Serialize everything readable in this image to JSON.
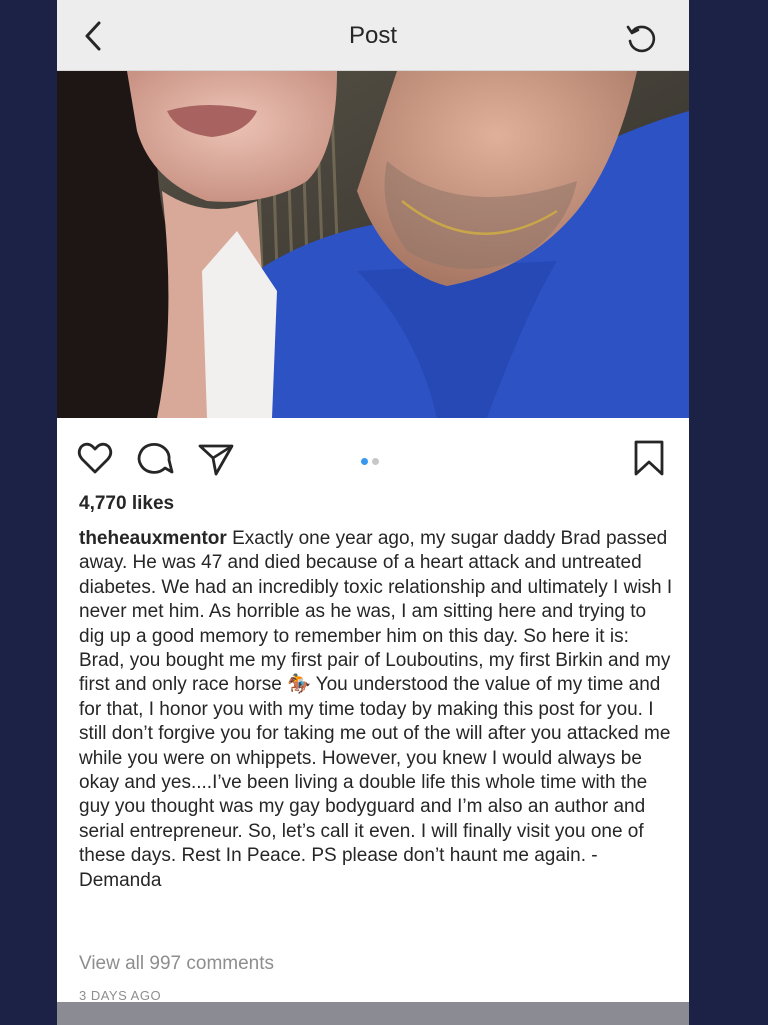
{
  "header": {
    "title": "Post",
    "back_icon": "chevron-left-icon",
    "refresh_icon": "refresh-icon"
  },
  "photo": {
    "description_icon": "photo"
  },
  "actions": {
    "like_icon": "heart-icon",
    "comment_icon": "comment-icon",
    "share_icon": "send-icon",
    "save_icon": "bookmark-icon",
    "carousel_active_color": "#3897f0",
    "carousel_inactive_color": "#c7c7c7"
  },
  "post": {
    "likes": "4,770 likes",
    "username": "theheauxmentor",
    "caption_part1": " Exactly one year ago, my sugar daddy Brad passed away. He was 47 and died because of a heart attack and untreated diabetes. We had an incredibly toxic relationship and ultimately I wish I never met him. As horrible as he was, I am sitting here and trying to dig up a good memory to remember him on this day. So here it is: Brad, you bought me my first pair of Louboutins, my first Birkin and my first and only race horse ",
    "emoji": "🏇",
    "caption_part2": " You understood the value of my time and for that, I honor you with my time today by making this post for you. I still don’t forgive you for taking me out of the will after you attacked me while you were on whippets. However, you knew I would always be okay and yes....I’ve been living a double life this whole time with the guy you thought was my gay bodyguard and I’m also an author and serial entrepreneur. So, let’s call it even. I will finally visit you one of these days. Rest In Peace. PS please don’t haunt me again. -Demanda",
    "view_comments": "View all 997 comments",
    "timestamp": "3 DAYS AGO"
  }
}
